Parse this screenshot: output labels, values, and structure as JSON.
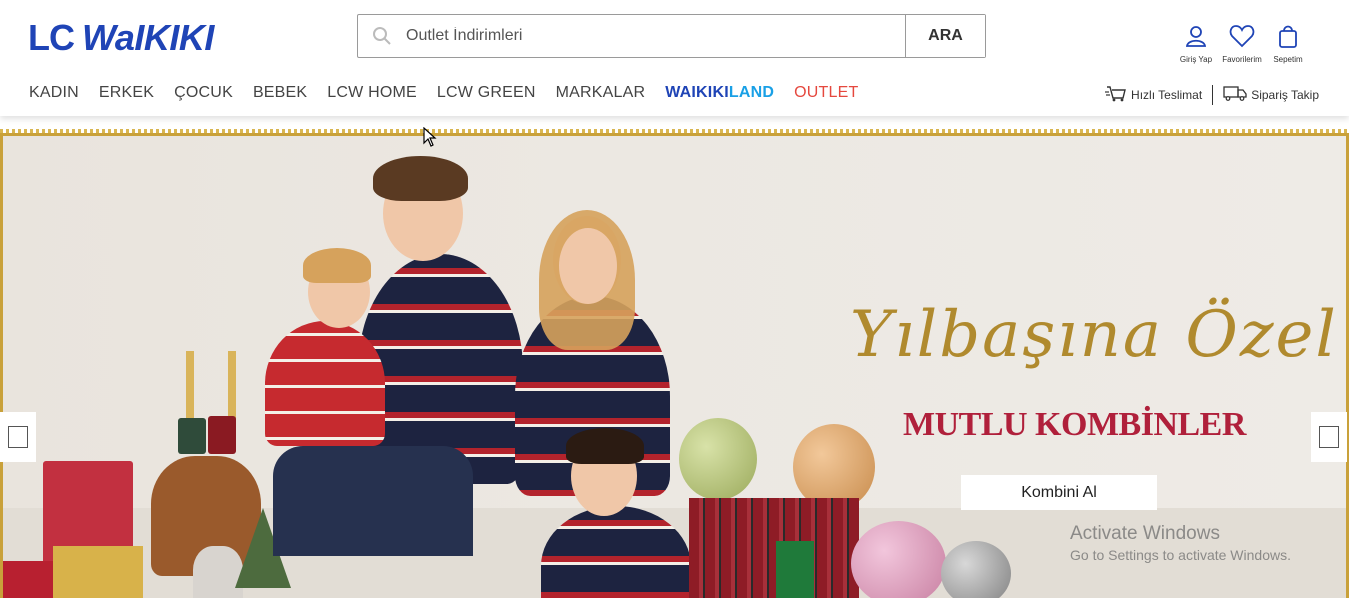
{
  "header": {
    "logo_lc": "LC",
    "logo_waikiki": "WaIKIKI",
    "search": {
      "placeholder": "Outlet İndirimleri",
      "button_label": "ARA"
    },
    "user_actions": [
      {
        "label": "Giriş Yap",
        "icon": "user-icon"
      },
      {
        "label": "Favorilerim",
        "icon": "heart-icon"
      },
      {
        "label": "Sepetim",
        "icon": "bag-icon"
      }
    ]
  },
  "nav": {
    "items": [
      "KADIN",
      "ERKEK",
      "ÇOCUK",
      "BEBEK",
      "LCW HOME",
      "LCW GREEN",
      "MARKALAR"
    ],
    "waikikiland_part1": "WAIKIKI",
    "waikikiland_part2": "LAND",
    "outlet": "OUTLET",
    "quick_delivery": "Hızlı Teslimat",
    "order_tracking": "Sipariş Takip"
  },
  "hero": {
    "script_title": "Yılbaşına Özel",
    "promo_title": "MUTLU KOMBİNLER",
    "cta_label": "Kombini Al"
  },
  "watermark": {
    "line1": "Activate Windows",
    "line2": "Go to Settings to activate Windows."
  },
  "colors": {
    "brand_blue": "#1f44b6",
    "land_blue": "#19a0e6",
    "outlet_red": "#e5483e",
    "promo_red": "#b0203b",
    "gold": "#c9a13a"
  }
}
